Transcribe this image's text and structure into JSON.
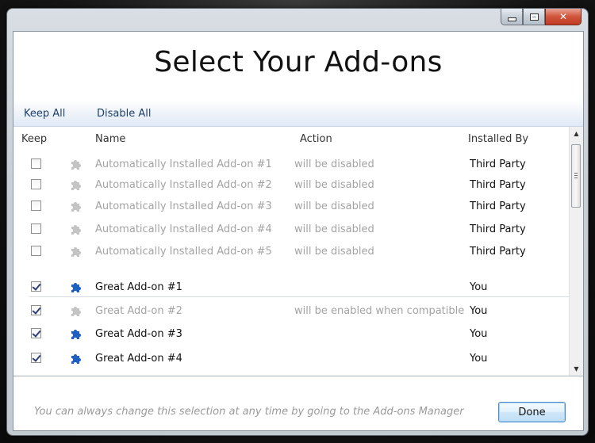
{
  "window": {
    "title": "Select Your Add-ons"
  },
  "toolbar": {
    "keep_all": "Keep All",
    "disable_all": "Disable All"
  },
  "list": {
    "columns": {
      "keep": "Keep",
      "name": "Name",
      "action": "Action",
      "installed_by": "Installed By"
    },
    "rows": [
      {
        "checked": false,
        "icon": "puzzle-piece-icon",
        "enabled": false,
        "name": "Automatically Installed Add-on #1",
        "action": "will be disabled",
        "installed_by": "Third Party"
      },
      {
        "checked": false,
        "icon": "puzzle-piece-icon",
        "enabled": false,
        "name": "Automatically Installed Add-on #2",
        "action": "will be disabled",
        "installed_by": "Third Party"
      },
      {
        "checked": false,
        "icon": "puzzle-piece-icon",
        "enabled": false,
        "name": "Automatically Installed Add-on #3",
        "action": "will be disabled",
        "installed_by": "Third Party"
      },
      {
        "checked": false,
        "icon": "puzzle-piece-icon",
        "enabled": false,
        "name": "Automatically Installed Add-on #4",
        "action": "will be disabled",
        "installed_by": "Third Party"
      },
      {
        "checked": false,
        "icon": "puzzle-piece-icon",
        "enabled": false,
        "name": "Automatically Installed Add-on #5",
        "action": "will be disabled",
        "installed_by": "Third Party"
      },
      {
        "checked": true,
        "icon": "puzzle-piece-icon",
        "enabled": true,
        "name": "Great Add-on #1",
        "action": "",
        "installed_by": "You"
      },
      {
        "checked": true,
        "icon": "puzzle-piece-icon",
        "enabled": false,
        "name": "Great Add-on #2",
        "action": "will be enabled when compatible",
        "installed_by": "You"
      },
      {
        "checked": true,
        "icon": "puzzle-piece-icon",
        "enabled": true,
        "name": "Great Add-on #3",
        "action": "",
        "installed_by": "You"
      },
      {
        "checked": true,
        "icon": "puzzle-piece-icon",
        "enabled": true,
        "name": "Great Add-on #4",
        "action": "",
        "installed_by": "You"
      }
    ]
  },
  "footer": {
    "hint": "You can always change this selection at any time by going to the Add-ons Manager",
    "done_label": "Done"
  },
  "colors": {
    "enabled_icon": "#1f5fbf",
    "disabled_icon": "#c4c4c4",
    "toolbar_link": "#1e3f6e"
  }
}
